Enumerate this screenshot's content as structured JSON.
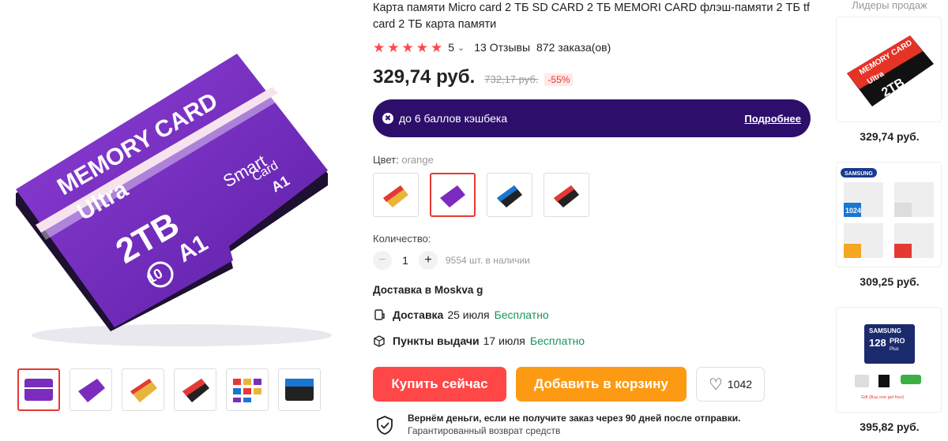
{
  "product": {
    "title": "Карта памяти Micro card 2 ТБ SD CARD 2 ТБ MEMORI CARD флэш-памяти 2 ТБ tf card 2 ТБ карта памяти",
    "rating": "5",
    "reviews": "13 Отзывы",
    "orders": "872 заказа(ов)",
    "price": "329,74 руб.",
    "old_price": "732,17 руб.",
    "discount": "-55%"
  },
  "main_image": {
    "line1": "MEMORY CARD",
    "line2": "Ultra",
    "smart": "Smart",
    "card": "Card",
    "a1": "A1",
    "capacity": "2TB",
    "class": "10",
    "a1_big": "A1"
  },
  "cashback": {
    "text": "до 6 баллов кэшбека",
    "more": "Подробнее"
  },
  "color": {
    "label": "Цвет:",
    "value": "orange",
    "swatches": [
      "#e8b53a",
      "#7b2cbf",
      "#1976d2",
      "#e53935"
    ]
  },
  "quantity": {
    "label": "Количество:",
    "minus": "−",
    "plus": "+",
    "value": "1",
    "stock": "9554 шт. в наличии"
  },
  "delivery": {
    "title": "Доставка в Moskva g",
    "courier_label": "Доставка",
    "courier_date": "25 июля",
    "courier_price": "Бесплатно",
    "pickup_label": "Пункты выдачи",
    "pickup_date": "17 июля",
    "pickup_price": "Бесплатно"
  },
  "actions": {
    "buy": "Купить сейчас",
    "cart": "Добавить в корзину",
    "wish_count": "1042"
  },
  "guarantee": {
    "title": "Вернём деньги, если не получите заказ через 90 дней после отправки.",
    "sub": "Гарантированный возврат средств"
  },
  "sidebar": {
    "heading": "Лидеры продаж",
    "items": [
      {
        "price": "329,74 руб.",
        "brand": "MEMORY CARD",
        "sub": "Ultra",
        "cap": "2TB"
      },
      {
        "price": "309,25 руб.",
        "brand": "SAMSUNG",
        "cap": "1024"
      },
      {
        "price": "395,82 руб.",
        "brand": "SAMSUNG",
        "cap": "128",
        "pro": "PRO",
        "plus": "Plus",
        "gift": "Gift (Buy one get four)"
      }
    ]
  }
}
